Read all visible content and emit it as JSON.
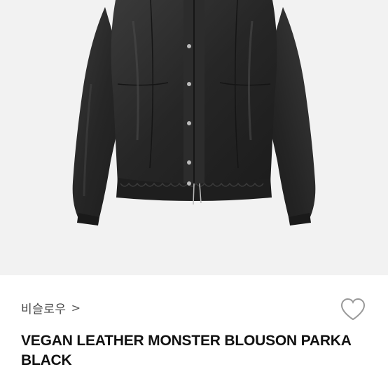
{
  "product": {
    "image_icon": "jacket-photo",
    "brand": "비슬로우",
    "brand_chevron": ">",
    "wishlist_icon": "heart-outline-icon",
    "title": "VEGAN LEATHER MONSTER BLOUSON PARKA BLACK"
  },
  "colors": {
    "image_background": "#f2f2f2",
    "jacket": "#2a2a2a",
    "title_text": "#111111",
    "brand_text": "#444444",
    "heart_outline": "#999999"
  }
}
